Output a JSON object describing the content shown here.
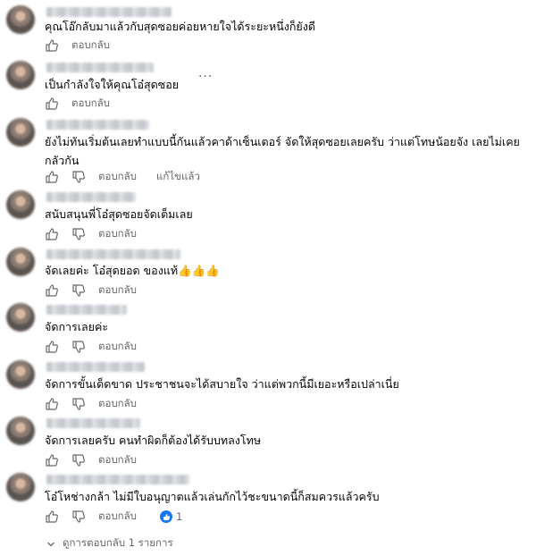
{
  "comments": [
    {
      "text": "คุณโอ๊กลับมาแล้วกับสุดซอยค่อยหายใจได้ระยะหนึ่งก็ยังดี",
      "reply_label": "ตอบกลับ"
    },
    {
      "text": "เป็นกำลังใจให้คุณโอ๋สุดซอย",
      "reply_label": "ตอบกลับ",
      "more": "···"
    },
    {
      "text": "ยังไม่ทันเริ่มต้นเลยทำแบบนี้กันแล้วคาด้าเซ็นเตอร์ จัดให้สุดซอยเลยครับ ว่าแต่โทษน้อยจัง เลยไม่เคยกลัวกัน",
      "reply_label": "ตอบกลับ",
      "edited_label": "แก้ไขแล้ว"
    },
    {
      "text": "สนับสนุนพี่โอ๋สุดซอยจัดเต็มเลย",
      "reply_label": "ตอบกลับ"
    },
    {
      "text": "จัดเลยค่ะ โอ๋สุดยอด ของแท้",
      "emoji": "👍👍👍",
      "reply_label": "ตอบกลับ"
    },
    {
      "text": "จัดการเลยค่ะ",
      "reply_label": "ตอบกลับ"
    },
    {
      "text": "จัดการขั้นเด็ดขาด ประชาชนจะได้สบายใจ ว่าแต่พวกนี้มีเยอะหรือเปล่าเนี่ย",
      "reply_label": "ตอบกลับ"
    },
    {
      "text": "จัดการเลยครับ คนทำผิดก็ต้องได้รับบทลงโทษ",
      "reply_label": "ตอบกลับ"
    },
    {
      "text": "โอ๋โหช่างกล้า ไม่มีใบอนุญาตแล้วเล่นกักไว้ชะขนาดนี้ก็สมควรแล้วครับ",
      "reply_label": "ตอบกลับ",
      "reaction_count": "1"
    }
  ],
  "view_replies": "ดูการตอบกลับ 1 รายการ",
  "colors": {
    "accent": "#1877f2",
    "muted": "#65676b"
  }
}
